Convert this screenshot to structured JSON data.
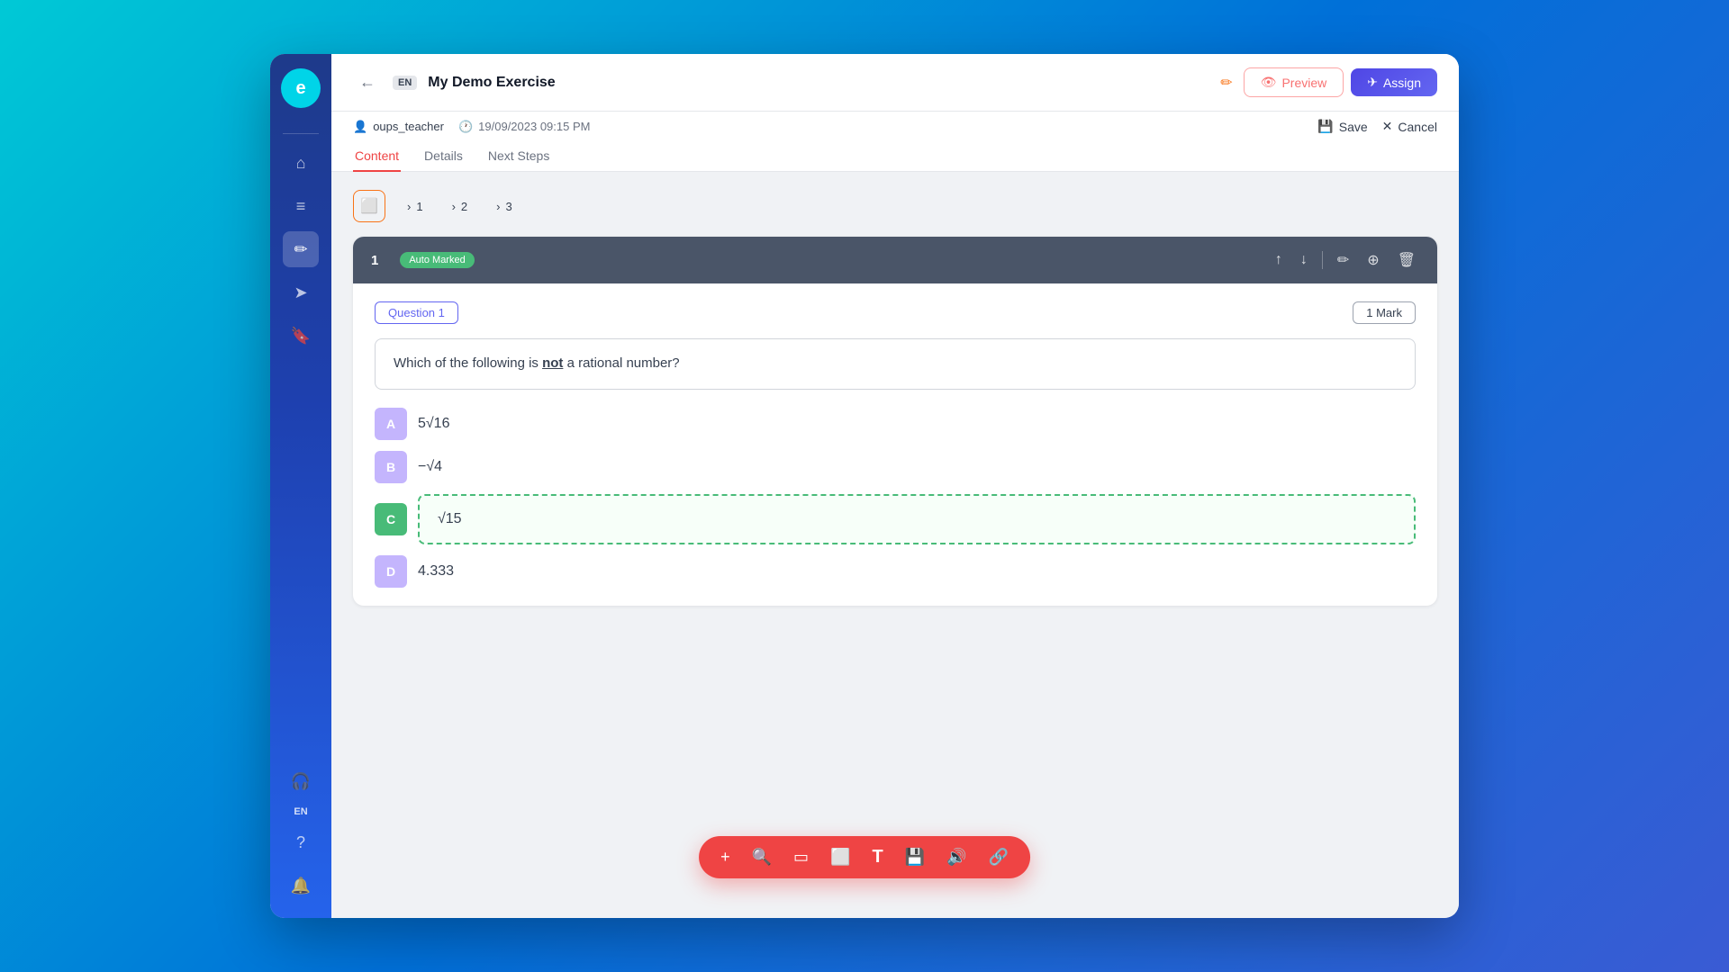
{
  "app": {
    "logo": "e",
    "back_label": "←"
  },
  "header": {
    "lang_badge": "EN",
    "title": "My Demo Exercise",
    "edit_icon": "✏",
    "preview_label": "Preview",
    "assign_label": "Assign",
    "preview_icon": "👁",
    "assign_icon": "✈"
  },
  "meta": {
    "user": "oups_teacher",
    "user_icon": "👤",
    "time": "19/09/2023 09:15 PM",
    "time_icon": "🕐",
    "save_label": "Save",
    "cancel_label": "Cancel"
  },
  "tabs": [
    {
      "id": "content",
      "label": "Content",
      "active": true
    },
    {
      "id": "details",
      "label": "Details",
      "active": false
    },
    {
      "id": "next-steps",
      "label": "Next Steps",
      "active": false
    }
  ],
  "toolbar": {
    "page_icon": "⬜",
    "pages": [
      {
        "num": "1"
      },
      {
        "num": "2"
      },
      {
        "num": "3"
      }
    ]
  },
  "question": {
    "number": "1",
    "auto_marked": "Auto Marked",
    "label": "Question 1",
    "mark": "1 Mark",
    "text": "Which of the following is not a rational number?",
    "options": [
      {
        "letter": "A",
        "text": "5√16",
        "correct": false
      },
      {
        "letter": "B",
        "text": "−√4",
        "correct": false
      },
      {
        "letter": "C",
        "text": "√15",
        "correct": true
      },
      {
        "letter": "D",
        "text": "4.333",
        "correct": false
      }
    ],
    "actions": {
      "up": "↑",
      "down": "↓",
      "edit": "✏",
      "add": "⊕",
      "delete": "🗑"
    }
  },
  "floating_toolbar": {
    "icons": [
      {
        "id": "add",
        "symbol": "+",
        "name": "add-icon"
      },
      {
        "id": "search",
        "symbol": "🔍",
        "name": "search-icon"
      },
      {
        "id": "rect",
        "symbol": "▭",
        "name": "rectangle-icon"
      },
      {
        "id": "screen",
        "symbol": "⬜",
        "name": "screen-icon"
      },
      {
        "id": "text",
        "symbol": "T",
        "name": "text-icon"
      },
      {
        "id": "save",
        "symbol": "💾",
        "name": "save-icon"
      },
      {
        "id": "audio",
        "symbol": "🔊",
        "name": "audio-icon"
      },
      {
        "id": "link",
        "symbol": "🔗",
        "name": "link-icon"
      }
    ]
  },
  "sidebar": {
    "icons": [
      {
        "id": "home",
        "symbol": "⌂",
        "name": "home-icon",
        "active": false
      },
      {
        "id": "library",
        "symbol": "📚",
        "name": "library-icon",
        "active": false
      },
      {
        "id": "edit",
        "symbol": "✏",
        "name": "edit-icon",
        "active": true
      },
      {
        "id": "send",
        "symbol": "➤",
        "name": "send-icon",
        "active": false
      },
      {
        "id": "bookmark",
        "symbol": "🔖",
        "name": "bookmark-icon",
        "active": false
      }
    ],
    "bottom_icons": [
      {
        "id": "headset",
        "symbol": "🎧",
        "name": "headset-icon"
      },
      {
        "id": "help",
        "symbol": "?",
        "name": "help-icon"
      },
      {
        "id": "bell",
        "symbol": "🔔",
        "name": "bell-icon"
      }
    ],
    "lang": "EN"
  }
}
